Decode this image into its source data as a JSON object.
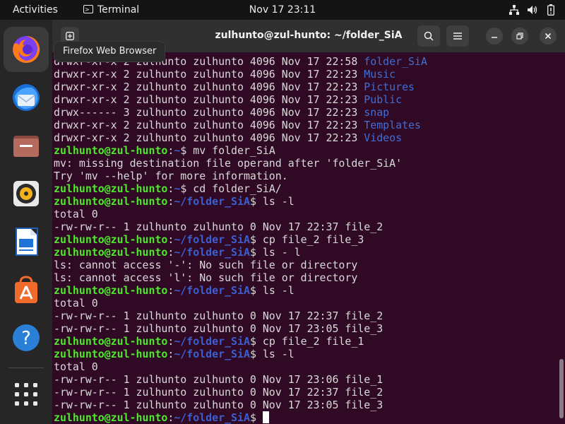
{
  "topbar": {
    "activities": "Activities",
    "app_name": "Terminal",
    "clock": "Nov 17  23:11",
    "tray_icons": [
      "network-icon",
      "volume-icon",
      "battery-icon"
    ]
  },
  "dock": {
    "tooltip": "Firefox Web Browser",
    "items": [
      {
        "icon": "firefox-icon"
      },
      {
        "icon": "thunderbird-icon"
      },
      {
        "icon": "files-icon"
      },
      {
        "icon": "rhythmbox-icon"
      },
      {
        "icon": "writer-icon"
      },
      {
        "icon": "app-center-icon"
      },
      {
        "icon": "help-icon"
      },
      {
        "icon": "show-apps-icon"
      }
    ]
  },
  "window": {
    "title": "zulhunto@zul-hunto: ~/folder_SiA"
  },
  "colors": {
    "terminal_bg": "#300a24",
    "prompt_user": "#4ee92c",
    "prompt_path": "#3b5fd1",
    "dir_listing": "#3f6ed4"
  },
  "terminal": {
    "lines": [
      {
        "type": "dirent",
        "text": "drwxr-xr-x 2 zulhunto zulhunto 4096 Nov 17 22:58 ",
        "name": "folder_SiA"
      },
      {
        "type": "dirent",
        "text": "drwxr-xr-x 2 zulhunto zulhunto 4096 Nov 17 22:23 ",
        "name": "Music"
      },
      {
        "type": "dirent",
        "text": "drwxr-xr-x 2 zulhunto zulhunto 4096 Nov 17 22:23 ",
        "name": "Pictures"
      },
      {
        "type": "dirent",
        "text": "drwxr-xr-x 2 zulhunto zulhunto 4096 Nov 17 22:23 ",
        "name": "Public"
      },
      {
        "type": "dirent",
        "text": "drwx------ 3 zulhunto zulhunto 4096 Nov 17 22:23 ",
        "name": "snap"
      },
      {
        "type": "dirent",
        "text": "drwxr-xr-x 2 zulhunto zulhunto 4096 Nov 17 22:23 ",
        "name": "Templates"
      },
      {
        "type": "dirent",
        "text": "drwxr-xr-x 2 zulhunto zulhunto 4096 Nov 17 22:23 ",
        "name": "Videos"
      },
      {
        "type": "prompt",
        "user": "zulhunto@zul-hunto",
        "path": "~",
        "cmd": " mv folder_SiA"
      },
      {
        "type": "text",
        "text": "mv: missing destination file operand after 'folder_SiA'"
      },
      {
        "type": "text",
        "text": "Try 'mv --help' for more information."
      },
      {
        "type": "prompt",
        "user": "zulhunto@zul-hunto",
        "path": "~",
        "cmd": " cd folder_SiA/"
      },
      {
        "type": "prompt",
        "user": "zulhunto@zul-hunto",
        "path": "~/folder_SiA",
        "cmd": " ls -l"
      },
      {
        "type": "text",
        "text": "total 0"
      },
      {
        "type": "text",
        "text": "-rw-rw-r-- 1 zulhunto zulhunto 0 Nov 17 22:37 file_2"
      },
      {
        "type": "prompt",
        "user": "zulhunto@zul-hunto",
        "path": "~/folder_SiA",
        "cmd": " cp file_2 file_3"
      },
      {
        "type": "prompt",
        "user": "zulhunto@zul-hunto",
        "path": "~/folder_SiA",
        "cmd": " ls - l"
      },
      {
        "type": "text",
        "text": "ls: cannot access '-': No such file or directory"
      },
      {
        "type": "text",
        "text": "ls: cannot access 'l': No such file or directory"
      },
      {
        "type": "prompt",
        "user": "zulhunto@zul-hunto",
        "path": "~/folder_SiA",
        "cmd": " ls -l"
      },
      {
        "type": "text",
        "text": "total 0"
      },
      {
        "type": "text",
        "text": "-rw-rw-r-- 1 zulhunto zulhunto 0 Nov 17 22:37 file_2"
      },
      {
        "type": "text",
        "text": "-rw-rw-r-- 1 zulhunto zulhunto 0 Nov 17 23:05 file_3"
      },
      {
        "type": "prompt",
        "user": "zulhunto@zul-hunto",
        "path": "~/folder_SiA",
        "cmd": " cp file_2 file_1"
      },
      {
        "type": "prompt",
        "user": "zulhunto@zul-hunto",
        "path": "~/folder_SiA",
        "cmd": " ls -l"
      },
      {
        "type": "text",
        "text": "total 0"
      },
      {
        "type": "text",
        "text": "-rw-rw-r-- 1 zulhunto zulhunto 0 Nov 17 23:06 file_1"
      },
      {
        "type": "text",
        "text": "-rw-rw-r-- 1 zulhunto zulhunto 0 Nov 17 22:37 file_2"
      },
      {
        "type": "text",
        "text": "-rw-rw-r-- 1 zulhunto zulhunto 0 Nov 17 23:05 file_3"
      },
      {
        "type": "prompt",
        "user": "zulhunto@zul-hunto",
        "path": "~/folder_SiA",
        "cmd": " ",
        "cursor": true
      }
    ]
  }
}
